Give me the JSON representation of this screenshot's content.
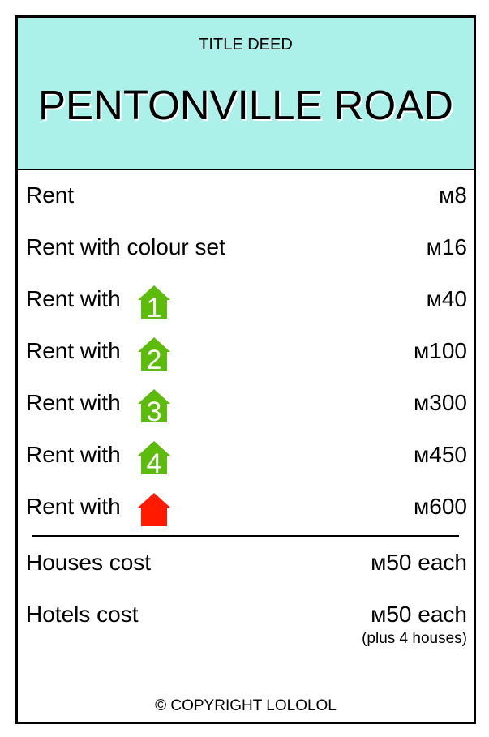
{
  "card": {
    "deed_label": "TITLE DEED",
    "property_name": "PENTONVILLE ROAD",
    "header_color": "#acf0ea"
  },
  "rents": [
    {
      "label": "Rent",
      "value": "м8"
    },
    {
      "label": "Rent with colour set",
      "value": "м16"
    },
    {
      "label": "Rent with",
      "icon": "house-1-icon",
      "icon_text": "1",
      "value": "м40"
    },
    {
      "label": "Rent with",
      "icon": "house-2-icon",
      "icon_text": "2",
      "value": "м100"
    },
    {
      "label": "Rent with",
      "icon": "house-3-icon",
      "icon_text": "3",
      "value": "м300"
    },
    {
      "label": "Rent with",
      "icon": "house-4-icon",
      "icon_text": "4",
      "value": "м450"
    },
    {
      "label": "Rent with",
      "icon": "hotel-icon",
      "value": "м600"
    }
  ],
  "costs": {
    "houses_label": "Houses cost",
    "houses_value": "м50 each",
    "hotels_label": "Hotels cost",
    "hotels_value": "м50 each",
    "hotels_note": "(plus 4 houses)"
  },
  "colors": {
    "house_green": "#5dbb0b",
    "hotel_red": "#ff1a00"
  },
  "footer": {
    "copyright": "© COPYRIGHT LOLOLOL"
  }
}
